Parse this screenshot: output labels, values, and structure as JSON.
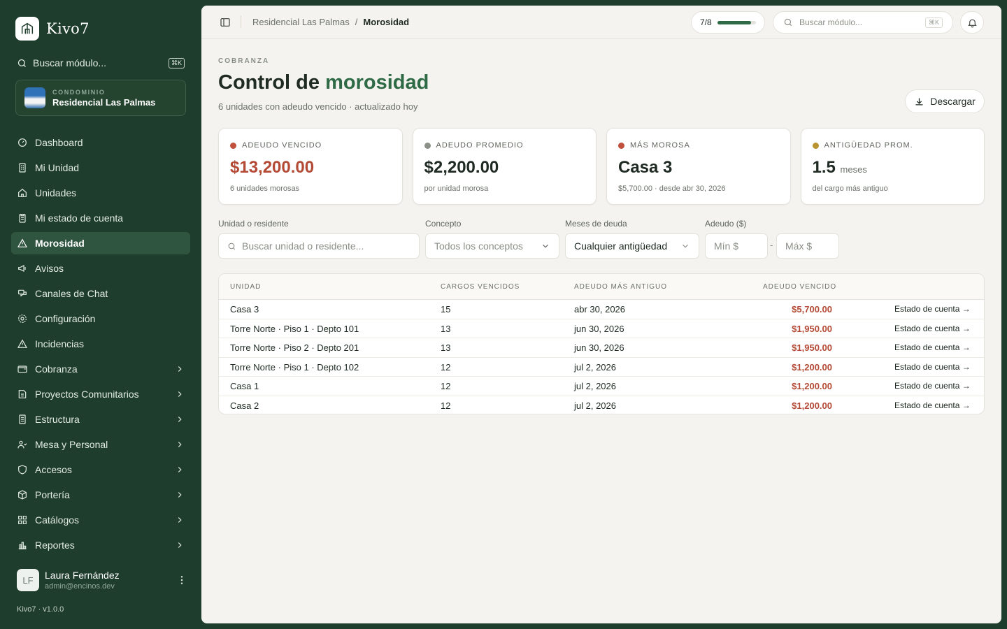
{
  "brand": {
    "name": "Kivo7"
  },
  "sidebar": {
    "search": {
      "label": "Buscar módulo...",
      "shortcut": "⌘K"
    },
    "condo": {
      "label": "CONDOMINIO",
      "name": "Residencial Las Palmas"
    },
    "items": [
      {
        "label": "Dashboard",
        "icon": "gauge-icon",
        "active": false,
        "chevron": false
      },
      {
        "label": "Mi Unidad",
        "icon": "building-icon",
        "active": false,
        "chevron": false
      },
      {
        "label": "Unidades",
        "icon": "home-icon",
        "active": false,
        "chevron": false
      },
      {
        "label": "Mi estado de cuenta",
        "icon": "clipboard-icon",
        "active": false,
        "chevron": false
      },
      {
        "label": "Morosidad",
        "icon": "alert-triangle-icon",
        "active": true,
        "chevron": false
      },
      {
        "label": "Avisos",
        "icon": "megaphone-icon",
        "active": false,
        "chevron": false
      },
      {
        "label": "Canales de Chat",
        "icon": "chat-icon",
        "active": false,
        "chevron": false
      },
      {
        "label": "Configuración",
        "icon": "gear-icon",
        "active": false,
        "chevron": false
      },
      {
        "label": "Incidencias",
        "icon": "warning-icon",
        "active": false,
        "chevron": false
      },
      {
        "label": "Cobranza",
        "icon": "wallet-icon",
        "active": false,
        "chevron": true
      },
      {
        "label": "Proyectos Comunitarios",
        "icon": "project-icon",
        "active": false,
        "chevron": true
      },
      {
        "label": "Estructura",
        "icon": "structure-icon",
        "active": false,
        "chevron": true
      },
      {
        "label": "Mesa y Personal",
        "icon": "users-icon",
        "active": false,
        "chevron": true
      },
      {
        "label": "Accesos",
        "icon": "shield-icon",
        "active": false,
        "chevron": true
      },
      {
        "label": "Portería",
        "icon": "box-icon",
        "active": false,
        "chevron": true
      },
      {
        "label": "Catálogos",
        "icon": "grid-icon",
        "active": false,
        "chevron": true
      },
      {
        "label": "Reportes",
        "icon": "bar-chart-icon",
        "active": false,
        "chevron": true
      }
    ],
    "user": {
      "initials": "LF",
      "name": "Laura Fernández",
      "email": "admin@encinos.dev"
    },
    "version": "Kivo7 · v1.0.0"
  },
  "topbar": {
    "breadcrumb": {
      "parent": "Residencial Las Palmas",
      "separator": "/",
      "current": "Morosidad"
    },
    "progress": {
      "label": "7/8",
      "fraction": 0.875
    },
    "search": {
      "placeholder": "Buscar módulo...",
      "shortcut": "⌘K"
    }
  },
  "header": {
    "eyebrow": "COBRANZA",
    "title_main": "Control de",
    "title_accent": "morosidad",
    "subtitle": "6 unidades con adeudo vencido · actualizado hoy",
    "download_label": "Descargar"
  },
  "stats": [
    {
      "label": "ADEUDO VENCIDO",
      "value": "$13,200.00",
      "unit": "",
      "note": "6 unidades morosas",
      "dot_color": "#c0503b",
      "value_red": true
    },
    {
      "label": "ADEUDO PROMEDIO",
      "value": "$2,200.00",
      "unit": "",
      "note": "por unidad morosa",
      "dot_color": "#8a8f87",
      "value_red": false
    },
    {
      "label": "MÁS MOROSA",
      "value": "Casa 3",
      "unit": "",
      "note": "$5,700.00 · desde abr 30, 2026",
      "dot_color": "#c0503b",
      "value_red": false
    },
    {
      "label": "ANTIGÜEDAD PROM.",
      "value": "1.5",
      "unit": "meses",
      "note": "del cargo más antiguo",
      "dot_color": "#b8932f",
      "value_red": false
    }
  ],
  "filters": {
    "unit": {
      "label": "Unidad o residente",
      "placeholder": "Buscar unidad o residente..."
    },
    "concept": {
      "label": "Concepto",
      "value": "Todos los conceptos"
    },
    "months": {
      "label": "Meses de deuda",
      "value": "Cualquier antigüedad"
    },
    "amount": {
      "label": "Adeudo ($)",
      "min_placeholder": "Mín $",
      "max_placeholder": "Máx $",
      "separator": "-"
    }
  },
  "table": {
    "columns": [
      "UNIDAD",
      "CARGOS VENCIDOS",
      "ADEUDO MÁS ANTIGUO",
      "ADEUDO VENCIDO"
    ],
    "action_label": "Estado de cuenta →",
    "rows": [
      {
        "unit": "Casa 3",
        "charges": "15",
        "oldest": "abr 30, 2026",
        "amount": "$5,700.00"
      },
      {
        "unit": "Torre Norte · Piso 1 · Depto 101",
        "charges": "13",
        "oldest": "jun 30, 2026",
        "amount": "$1,950.00"
      },
      {
        "unit": "Torre Norte · Piso 2 · Depto 201",
        "charges": "13",
        "oldest": "jun 30, 2026",
        "amount": "$1,950.00"
      },
      {
        "unit": "Torre Norte · Piso 1 · Depto 102",
        "charges": "12",
        "oldest": "jul 2, 2026",
        "amount": "$1,200.00"
      },
      {
        "unit": "Casa 1",
        "charges": "12",
        "oldest": "jul 2, 2026",
        "amount": "$1,200.00"
      },
      {
        "unit": "Casa 2",
        "charges": "12",
        "oldest": "jul 2, 2026",
        "amount": "$1,200.00"
      }
    ]
  }
}
